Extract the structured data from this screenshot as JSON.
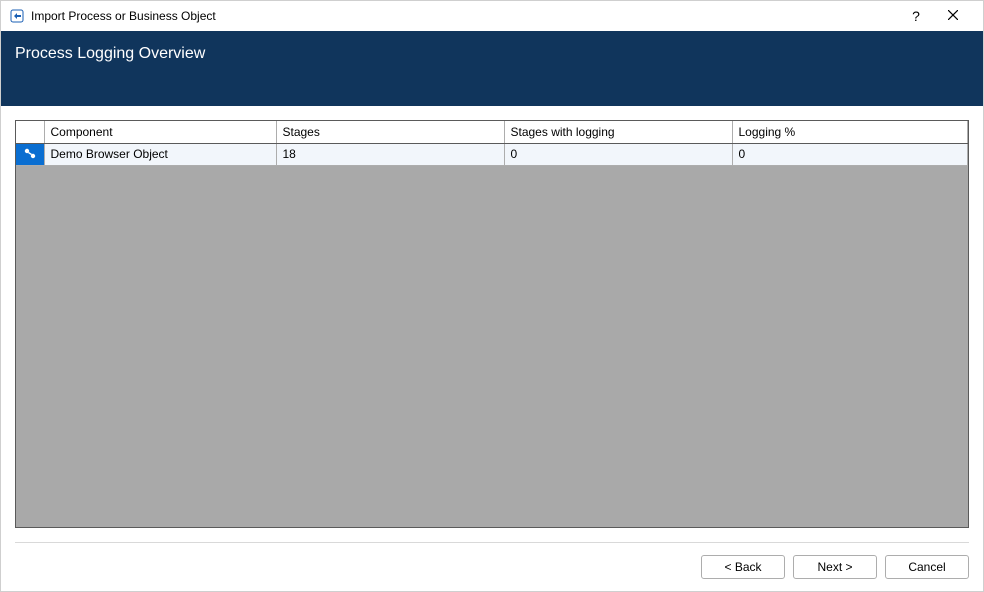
{
  "window": {
    "title": "Import Process or Business Object",
    "help_tooltip": "?",
    "close_tooltip": "Close"
  },
  "banner": {
    "title": "Process Logging Overview"
  },
  "grid": {
    "columns": {
      "component": "Component",
      "stages": "Stages",
      "stages_with_logging": "Stages with logging",
      "logging_pct": "Logging %"
    },
    "rows": [
      {
        "icon": "object-icon",
        "component": "Demo Browser Object",
        "stages": "18",
        "stages_with_logging": "0",
        "logging_pct": "0"
      }
    ]
  },
  "footer": {
    "back": "< Back",
    "next": "Next >",
    "cancel": "Cancel"
  }
}
